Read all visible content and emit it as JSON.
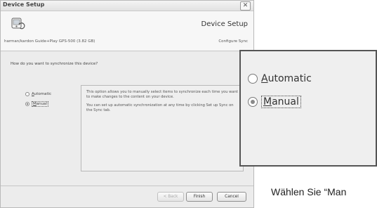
{
  "dialog": {
    "title": "Device Setup",
    "close_glyph": "✕",
    "header_title": "Device Setup",
    "device_name": "harman/kardon Guide+Play GPS-500 (3.82 GB)",
    "step_label": "Configure Sync",
    "question": "How do you want to synchronize this device?",
    "options": [
      {
        "label": "Automatic",
        "accel": "A",
        "rest": "utomatic",
        "selected": false
      },
      {
        "label": "Manual",
        "accel": "M",
        "rest": "anual",
        "selected": true
      }
    ],
    "info_paragraph_1": "This option allows you to manually select items to synchronize each time you want to make changes to the content on your device.",
    "info_paragraph_2": "You can set up automatic synchronization at any time by clicking Set up Sync on the Sync tab.",
    "buttons": {
      "back": "< Back",
      "finish": "Finish",
      "cancel": "Cancel"
    }
  },
  "zoom_callout": {
    "options": [
      {
        "accel": "A",
        "rest": "utomatic",
        "selected": false
      },
      {
        "accel": "M",
        "rest": "anual",
        "selected": true
      }
    ]
  },
  "caption": "Wählen Sie “Man"
}
